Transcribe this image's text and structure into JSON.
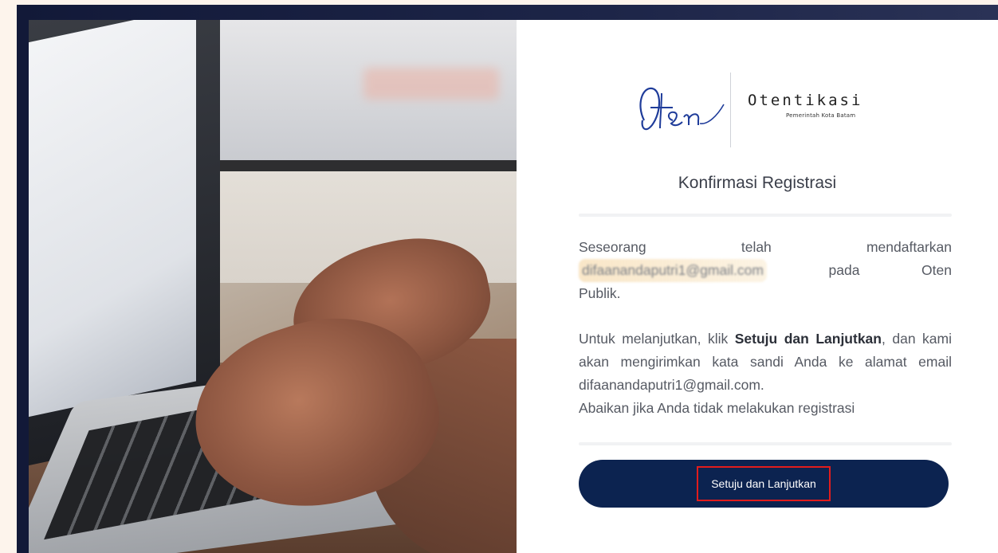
{
  "brand": {
    "script_logo": "Oten",
    "name": "Otentikasi",
    "subtitle": "Pemerintah Kota Batam"
  },
  "page": {
    "title": "Konfirmasi Registrasi"
  },
  "message": {
    "line1_word1": "Seseorang",
    "line1_word2": "telah",
    "line1_word3": "mendaftarkan",
    "redacted_email": "difaanandaputri1@gmail.com",
    "line2_word1": "pada",
    "line2_word2": "Oten",
    "line3": "Publik.",
    "instruction_prefix": "Untuk melanjutkan, klik ",
    "instruction_bold": "Setuju dan Lanjutkan",
    "instruction_suffix": ", dan kami akan mengirimkan kata sandi Anda ke alamat email difaanandaputri1@gmail.com.",
    "instruction_last": "Abaikan jika Anda tidak melakukan registrasi"
  },
  "actions": {
    "confirm_label": "Setuju dan Lanjutkan",
    "highlight_color": "#e21c1c",
    "button_color": "#0c2350"
  }
}
